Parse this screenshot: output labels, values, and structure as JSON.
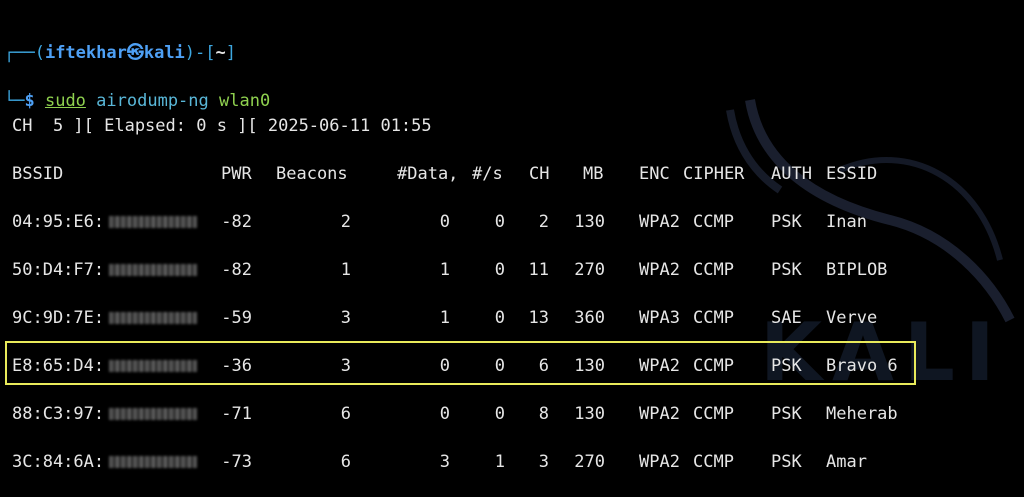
{
  "prompt": {
    "user": "iftekhar",
    "at_symbol": "㉿",
    "host": "kali",
    "dir": "~",
    "sudo": "sudo",
    "command": "airodump-ng",
    "argument": "wlan0"
  },
  "status_line": "CH  5 ][ Elapsed: 0 s ][ 2025-06-11 01:55",
  "columns": [
    "BSSID",
    "PWR",
    "Beacons",
    "#Data,",
    "#/s",
    "CH",
    "MB",
    "ENC",
    "CIPHER",
    "AUTH",
    "ESSID"
  ],
  "rows": [
    {
      "bssid": "04:95:E6:",
      "pwr": "-82",
      "beacons": "2",
      "data": "0",
      "per_s": "0",
      "ch": "2",
      "mb": "130",
      "enc": "WPA2",
      "cipher": "CCMP",
      "auth": "PSK",
      "essid": "Inan"
    },
    {
      "bssid": "50:D4:F7:",
      "pwr": "-82",
      "beacons": "1",
      "data": "1",
      "per_s": "0",
      "ch": "11",
      "mb": "270",
      "enc": "WPA2",
      "cipher": "CCMP",
      "auth": "PSK",
      "essid": "BIPLOB"
    },
    {
      "bssid": "9C:9D:7E:",
      "pwr": "-59",
      "beacons": "3",
      "data": "1",
      "per_s": "0",
      "ch": "13",
      "mb": "360",
      "enc": "WPA3",
      "cipher": "CCMP",
      "auth": "SAE",
      "essid": "Verve"
    },
    {
      "bssid": "E8:65:D4:",
      "pwr": "-36",
      "beacons": "3",
      "data": "0",
      "per_s": "0",
      "ch": "6",
      "mb": "130",
      "enc": "WPA2",
      "cipher": "CCMP",
      "auth": "PSK",
      "essid": "Bravo 6"
    },
    {
      "bssid": "88:C3:97:",
      "pwr": "-71",
      "beacons": "6",
      "data": "0",
      "per_s": "0",
      "ch": "8",
      "mb": "130",
      "enc": "WPA2",
      "cipher": "CCMP",
      "auth": "PSK",
      "essid": "Meherab"
    },
    {
      "bssid": "3C:84:6A:",
      "pwr": "-73",
      "beacons": "6",
      "data": "3",
      "per_s": "1",
      "ch": "3",
      "mb": "270",
      "enc": "WPA2",
      "cipher": "CCMP",
      "auth": "PSK",
      "essid": "Amar"
    }
  ],
  "highlighted_essid": "Bravo 6",
  "colors": {
    "background": "#000000",
    "text": "#e6e6e6",
    "prompt_blue": "#4ea0f5",
    "highlight": "#e8ea5a"
  }
}
